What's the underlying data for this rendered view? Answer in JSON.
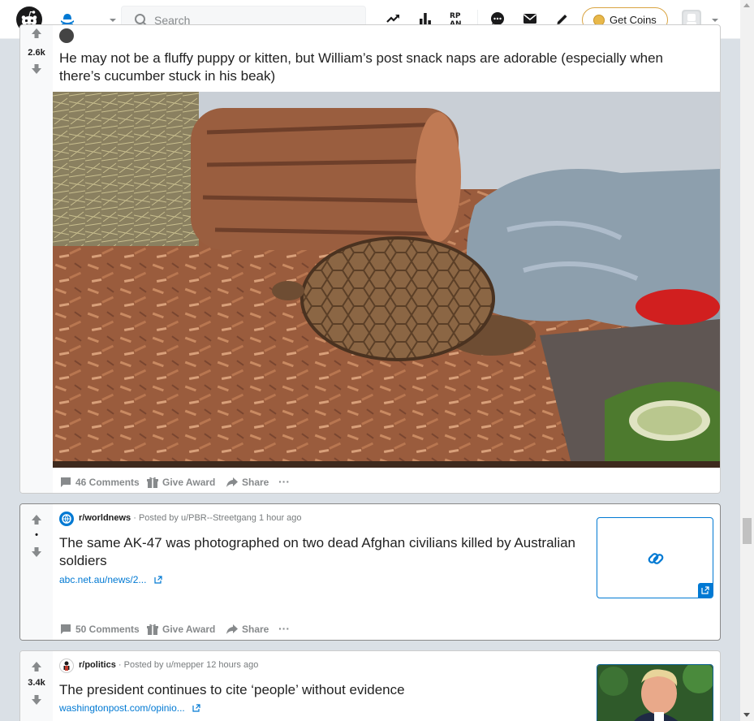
{
  "header": {
    "search_placeholder": "Search",
    "get_coins_label": "Get Coins",
    "icons": [
      "reddit-logo",
      "home-icon",
      "popular-icon",
      "all-icon",
      "rpan-icon",
      "chat-icon",
      "mail-icon",
      "create-post-icon",
      "coin-icon",
      "avatar"
    ]
  },
  "posts": [
    {
      "score": "2.6k",
      "title": "He may not be a fluffy puppy or kitten, but William’s post snack naps are adorable (especially when there’s cucumber stuck in his beak)",
      "image": "tortoise resting on wood chips beside a log hide and cucumber slices",
      "actions": {
        "comments": "46 Comments",
        "award": "Give Award",
        "share": "Share",
        "more": "···"
      }
    },
    {
      "score": "•",
      "subreddit": "r/worldnews",
      "posted_by": "· Posted by u/PBR--Streetgang 1 hour ago",
      "title": "The same AK-47 was photographed on two dead Afghan civilians killed by Australian soldiers",
      "link": "abc.net.au/news/2...",
      "actions": {
        "comments": "50 Comments",
        "award": "Give Award",
        "share": "Share",
        "more": "···"
      }
    },
    {
      "score": "3.4k",
      "subreddit": "r/politics",
      "posted_by": "· Posted by u/mepper 12 hours ago",
      "title": "The president continues to cite ‘people’ without evidence",
      "link": "washingtonpost.com/opinio..."
    }
  ],
  "colors": {
    "accent": "#0079d3",
    "upvote": "#878a8c",
    "coin_border": "#d9a441"
  }
}
